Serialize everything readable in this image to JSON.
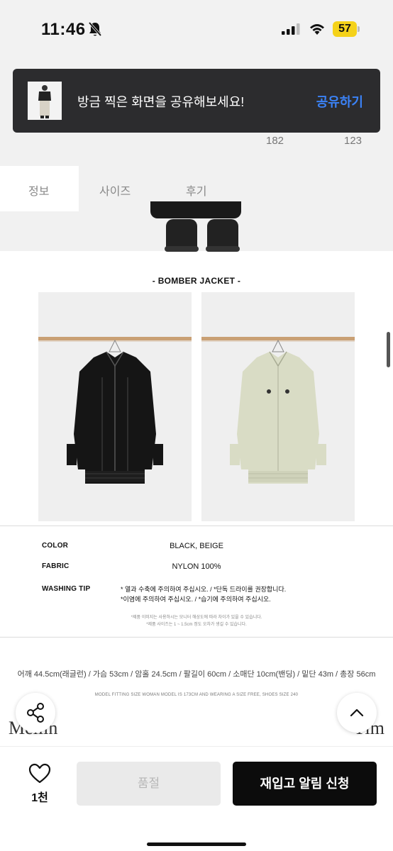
{
  "status_bar": {
    "time": "11:46",
    "battery": "57",
    "battery_color": "#f5d21a"
  },
  "hero": {
    "tabs": [
      "정보",
      "사이즈",
      "후기"
    ],
    "counts": [
      "182",
      "123"
    ]
  },
  "share_banner": {
    "text": "방금 찍은 화면을 공유해보세요!",
    "action": "공유하기",
    "action_color": "#3b82f6"
  },
  "product": {
    "section_title": "- BOMBER JACKET -",
    "images": [
      {
        "name": "black-bomber-jacket",
        "color": "#151515"
      },
      {
        "name": "beige-bomber-jacket",
        "color": "#d9dcc5"
      }
    ]
  },
  "specs": {
    "color_label": "COLOR",
    "color_value": "BLACK, BEIGE",
    "fabric_label": "FABRIC",
    "fabric_value": "NYLON 100%",
    "washing_label": "WASHING TIP",
    "washing_lines": [
      "* 열과 수축에 주의하여 주십시오. / *단독 드라이를 권장합니다.",
      "*이염에 주의하여 주십시오. / *습기에 주의하여 주십시오."
    ],
    "notes": [
      "*제품 이미지는 사용하시는 모니터 해상도에 따라 차이가 있을 수 있습니다.",
      "*제품 사이즈는 1 ~ 1.5cm 정도 오차가 생길 수 있습니다."
    ]
  },
  "measurements": "어깨 44.5cm(래글런) / 가슴 53cm / 암홀 24.5cm / 팔길이 60cm / 소매단 10cm(밴딩) / 밑단 43m / 총장 56cm",
  "fitting_size": "MODEL FITTING SIZE   WOMAN MODEL IS 173CM AND WEARING A SIZE FREE, SHOES SIZE 240",
  "model_names": [
    "Mellin",
    "Yim"
  ],
  "bottom_bar": {
    "like_count": "1천",
    "soldout_label": "품절",
    "restock_label": "재입고 알림 신청"
  }
}
